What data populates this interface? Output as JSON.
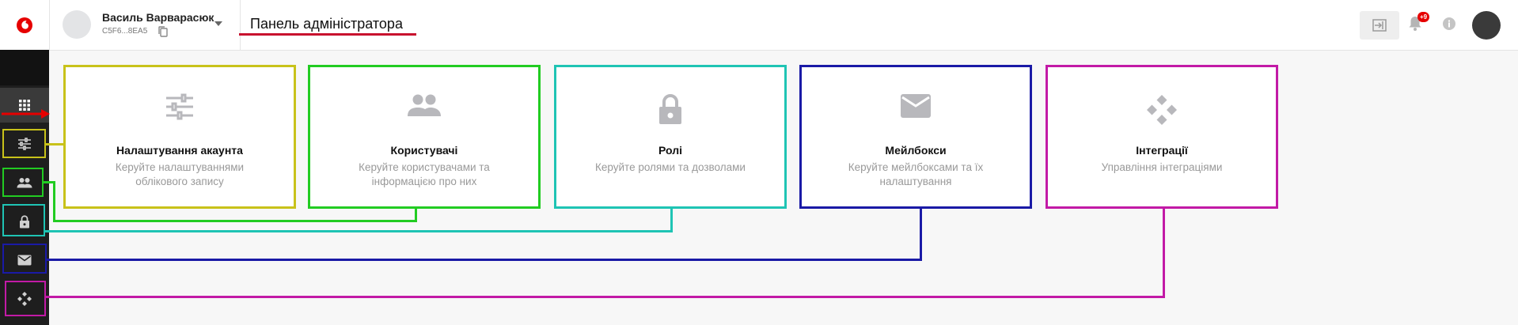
{
  "topbar": {
    "user_name": "Василь Варварасюк",
    "user_id": "C5F6...8EA5",
    "page_title": "Панель адміністратора",
    "notification_count": "+9"
  },
  "sidebar": {
    "items": [
      "apps-icon",
      "tune-icon",
      "people-icon",
      "lock-icon",
      "mail-icon",
      "integrations-icon"
    ]
  },
  "cards": [
    {
      "title": "Налаштування акаунта",
      "desc": "Керуйте налаштуваннями облікового запису",
      "icon": "tune-icon",
      "color": "#c8c21a"
    },
    {
      "title": "Користувачі",
      "desc": "Керуйте користувачами та інформацією про них",
      "icon": "people-icon",
      "color": "#22cc22"
    },
    {
      "title": "Ролі",
      "desc": "Керуйте ролями та дозволами",
      "icon": "lock-icon",
      "color": "#1fc4b4"
    },
    {
      "title": "Мейлбокси",
      "desc": "Керуйте мейлбоксами та їх налаштування",
      "icon": "mail-icon",
      "color": "#1a1aa6"
    },
    {
      "title": "Інтеграції",
      "desc": "Управління інтеграціями",
      "icon": "integrations-icon",
      "color": "#c21aa6"
    }
  ],
  "colors": {
    "accent": "#e60000",
    "annotation_red": "#c8102e",
    "icon_grey": "#b8b8bc"
  }
}
